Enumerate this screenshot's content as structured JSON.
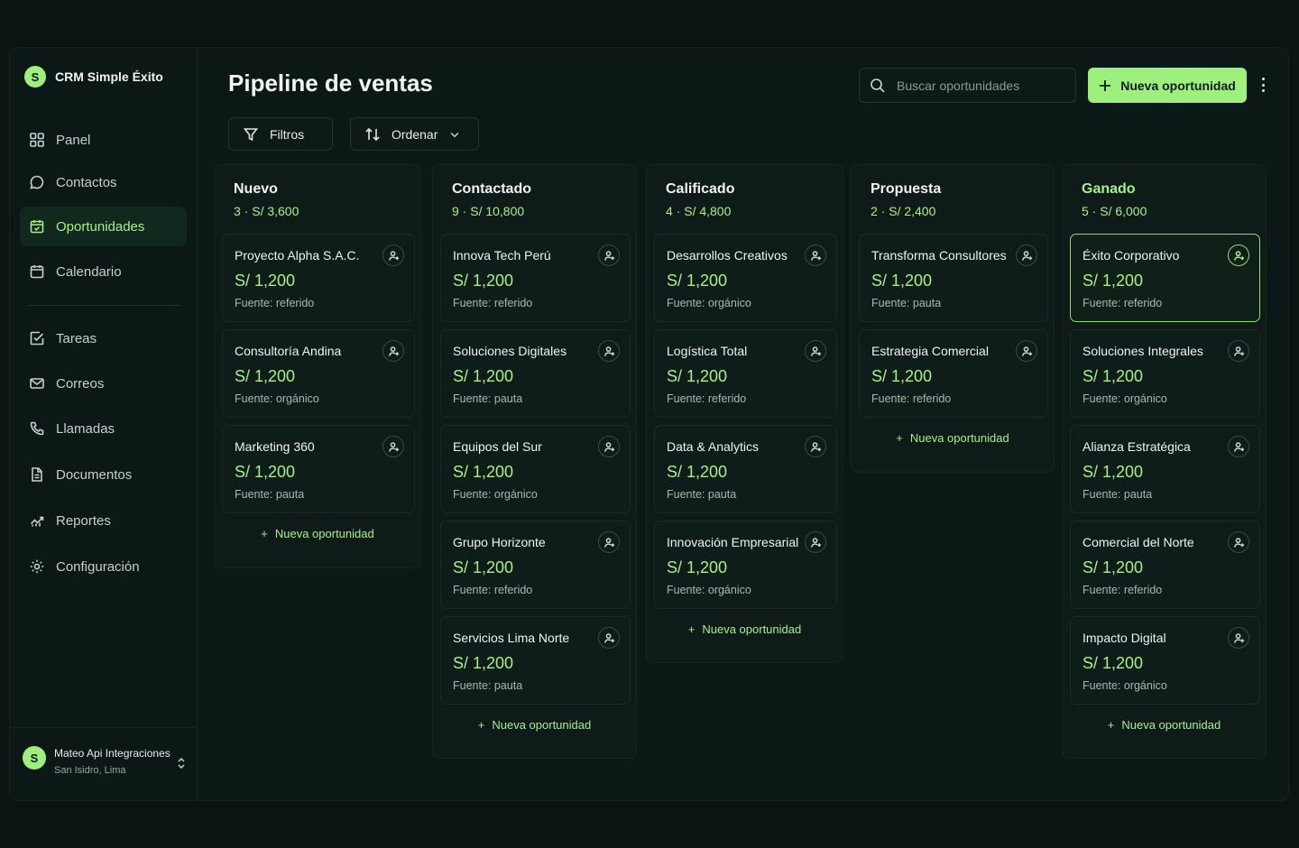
{
  "app": {
    "brand_initial": "S",
    "brand_name": "CRM Simple Éxito"
  },
  "sidebar": {
    "items": [
      {
        "label": "Panel",
        "icon": "grid-icon",
        "active": false
      },
      {
        "label": "Contactos",
        "icon": "chat-icon",
        "active": false
      },
      {
        "label": "Oportunidades",
        "icon": "calendar-check-icon",
        "active": true
      },
      {
        "label": "Calendario",
        "icon": "calendar-icon",
        "active": false
      },
      {
        "label": "Tareas",
        "icon": "checkbox-icon",
        "active": false
      },
      {
        "label": "Correos",
        "icon": "mail-icon",
        "active": false
      },
      {
        "label": "Llamadas",
        "icon": "phone-icon",
        "active": false
      },
      {
        "label": "Documentos",
        "icon": "document-icon",
        "active": false
      },
      {
        "label": "Reportes",
        "icon": "chart-icon",
        "active": false
      },
      {
        "label": "Configuración",
        "icon": "gear-icon",
        "active": false
      }
    ],
    "user": {
      "initial": "S",
      "name": "Mateo Api Integraciones",
      "location": "San Isidro, Lima"
    }
  },
  "header": {
    "title": "Pipeline de ventas",
    "search_placeholder": "Buscar oportunidades",
    "new_button": "Nueva oportunidad",
    "filters_label": "Filtros",
    "sort_label": "Ordenar"
  },
  "colors": {
    "accent": "#9ef07c",
    "background": "#0a1513",
    "panel": "#0e1b18"
  },
  "board": {
    "add_label": "Nueva oportunidad",
    "columns": [
      {
        "title": "Nuevo",
        "meta": "3 · S/ 3,600",
        "cards": [
          {
            "title": "Proyecto Alpha S.A.C.",
            "value": "S/ 1,200",
            "source": "Fuente: referido"
          },
          {
            "title": "Consultoría Andina",
            "value": "S/ 1,200",
            "source": "Fuente: orgánico"
          },
          {
            "title": "Marketing 360",
            "value": "S/ 1,200",
            "source": "Fuente: pauta"
          }
        ]
      },
      {
        "title": "Contactado",
        "meta": "9 · S/ 10,800",
        "cards": [
          {
            "title": "Innova Tech Perú",
            "value": "S/ 1,200",
            "source": "Fuente: referido"
          },
          {
            "title": "Soluciones Digitales",
            "value": "S/ 1,200",
            "source": "Fuente: pauta"
          },
          {
            "title": "Equipos del Sur",
            "value": "S/ 1,200",
            "source": "Fuente: orgánico"
          },
          {
            "title": "Grupo Horizonte",
            "value": "S/ 1,200",
            "source": "Fuente: referido"
          },
          {
            "title": "Servicios Lima Norte",
            "value": "S/ 1,200",
            "source": "Fuente: pauta"
          }
        ]
      },
      {
        "title": "Calificado",
        "meta": "4 · S/ 4,800",
        "cards": [
          {
            "title": "Desarrollos Creativos",
            "value": "S/ 1,200",
            "source": "Fuente: orgánico"
          },
          {
            "title": "Logística Total",
            "value": "S/ 1,200",
            "source": "Fuente: referido"
          },
          {
            "title": "Data & Analytics",
            "value": "S/ 1,200",
            "source": "Fuente: pauta"
          },
          {
            "title": "Innovación Empresarial",
            "value": "S/ 1,200",
            "source": "Fuente: orgánico"
          }
        ]
      },
      {
        "title": "Propuesta",
        "meta": "2 · S/ 2,400",
        "cards": [
          {
            "title": "Transforma Consultores",
            "value": "S/ 1,200",
            "source": "Fuente: pauta"
          },
          {
            "title": "Estrategia Comercial",
            "value": "S/ 1,200",
            "source": "Fuente: referido"
          }
        ]
      },
      {
        "title": "Ganado",
        "meta": "5 · S/ 6,000",
        "cards": [
          {
            "title": "Éxito Corporativo",
            "value": "S/ 1,200",
            "source": "Fuente: referido"
          },
          {
            "title": "Soluciones Integrales",
            "value": "S/ 1,200",
            "source": "Fuente: orgánico"
          },
          {
            "title": "Alianza Estratégica",
            "value": "S/ 1,200",
            "source": "Fuente: pauta"
          },
          {
            "title": "Comercial del Norte",
            "value": "S/ 1,200",
            "source": "Fuente: referido"
          },
          {
            "title": "Impacto Digital",
            "value": "S/ 1,200",
            "source": "Fuente: orgánico"
          }
        ]
      }
    ]
  }
}
